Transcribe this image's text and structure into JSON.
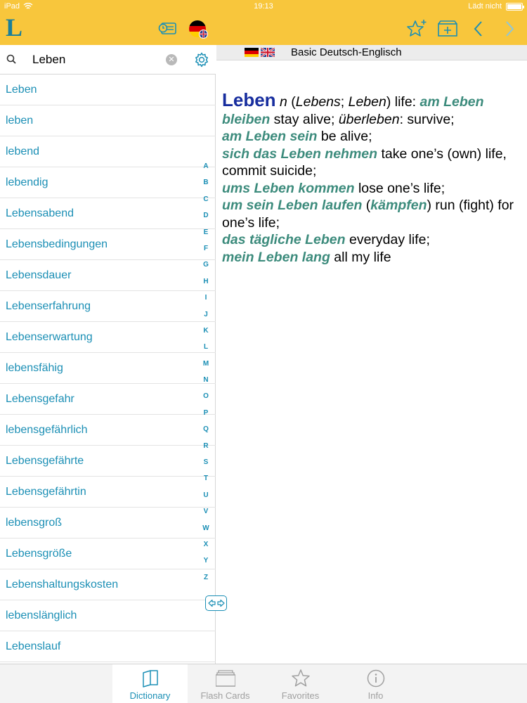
{
  "status": {
    "device": "iPad",
    "time": "19:13",
    "charging": "Lädt nicht"
  },
  "search": {
    "value": "Leben",
    "placeholder": ""
  },
  "words": [
    "Leben",
    "leben",
    "lebend",
    "lebendig",
    "Lebensabend",
    "Lebensbedingungen",
    "Lebensdauer",
    "Lebenserfahrung",
    "Lebenserwartung",
    "lebensfähig",
    "Lebensgefahr",
    "lebensgefährlich",
    "Lebensgefährte",
    "Lebensgefährtin",
    "lebensgroß",
    "Lebensgröße",
    "Lebenshaltungskosten",
    "lebenslänglich",
    "Lebenslauf"
  ],
  "alphabet": [
    "A",
    "B",
    "C",
    "D",
    "E",
    "F",
    "G",
    "H",
    "I",
    "J",
    "K",
    "L",
    "M",
    "N",
    "O",
    "P",
    "Q",
    "R",
    "S",
    "T",
    "U",
    "V",
    "W",
    "X",
    "Y",
    "Z"
  ],
  "dictionary": {
    "title": "Basic Deutsch-Englisch"
  },
  "entry": {
    "headword": "Leben",
    "pos": "n",
    "grammar": {
      "open": " (",
      "g1": "Lebens",
      "sep": "; ",
      "g2": "Leben",
      "close": ") life: "
    },
    "p1": {
      "ex": "am Leben bleiben",
      "tr": " stay alive; ",
      "alt": "überleben",
      "tail": ": survive;"
    },
    "p2": {
      "ex": "am Leben sein",
      "tr": " be alive;"
    },
    "p3": {
      "ex": "sich das Leben nehmen",
      "tr": " take one’s (own) life, commit suicide;"
    },
    "p4": {
      "ex": "ums Leben kommen",
      "tr": " lose one’s life;"
    },
    "p5": {
      "ex": "um sein Leben laufen",
      "open": " (",
      "ex2": "kämpfen",
      "tr": ") run (fight) for one’s life;"
    },
    "p6": {
      "ex": "das tägliche Leben",
      "tr": " everyday life;"
    },
    "p7": {
      "ex": "mein Leben lang",
      "tr": " all my life"
    }
  },
  "tabs": [
    {
      "label": "Dictionary",
      "icon": "book-icon"
    },
    {
      "label": "Flash Cards",
      "icon": "flashcards-icon"
    },
    {
      "label": "Favorites",
      "icon": "star-icon"
    },
    {
      "label": "Info",
      "icon": "info-icon"
    }
  ],
  "colors": {
    "bar": "#f8c63c",
    "accent": "#1b8fb5",
    "headword": "#172d9e",
    "example": "#3c8b7c"
  }
}
